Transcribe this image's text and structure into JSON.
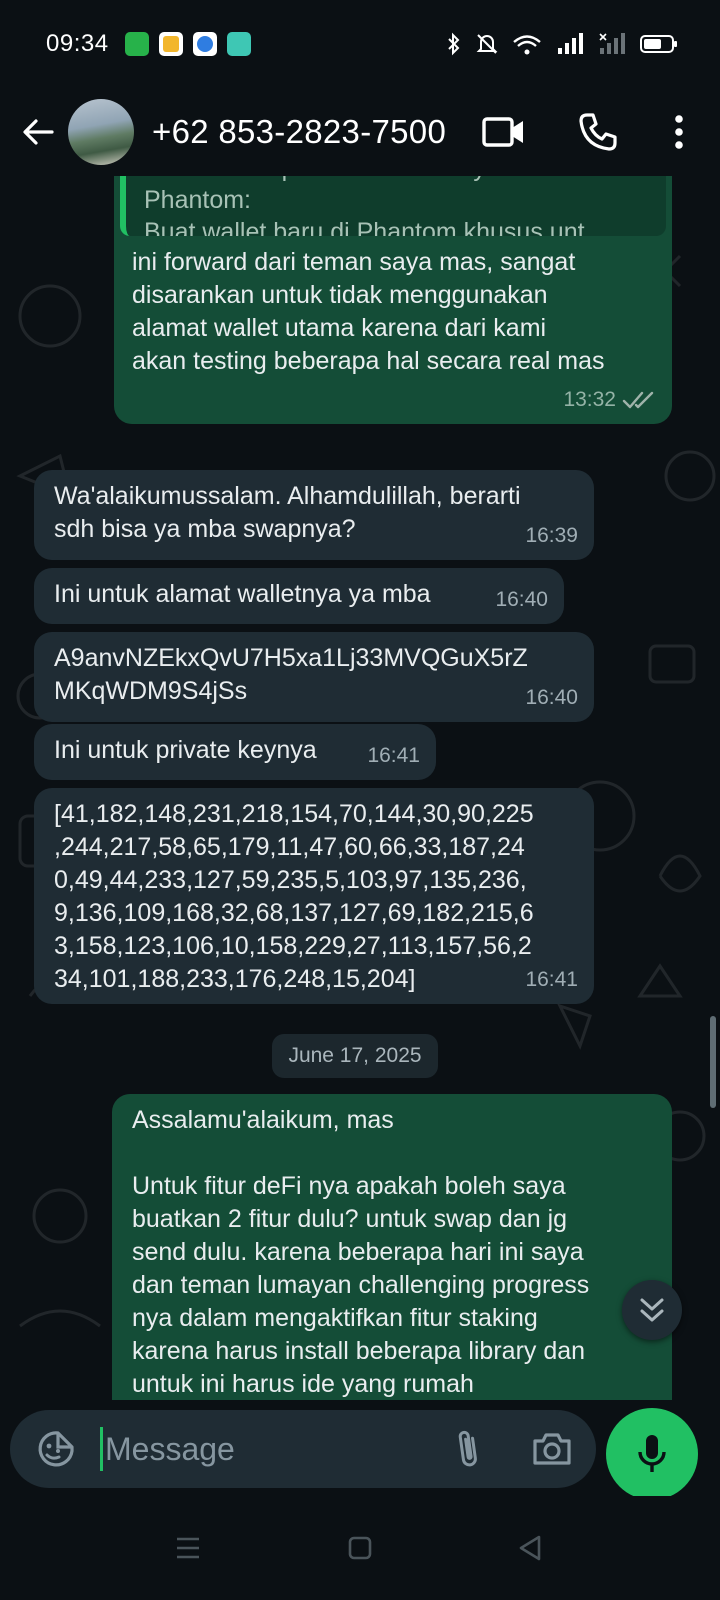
{
  "status_bar": {
    "time": "09:34",
    "app_icons": [
      {
        "name": "calculator-app-icon",
        "color": "#27b24a"
      },
      {
        "name": "notes-app-icon",
        "color": "#f2b62c"
      },
      {
        "name": "browser-app-icon",
        "color": "#2f7de1"
      },
      {
        "name": "assistant-app-icon",
        "color": "#3ec7b4"
      }
    ],
    "bluetooth": "on",
    "notifications": "muted",
    "wifi": "connected",
    "battery_level": 0.55
  },
  "header": {
    "contact_name": "+62 853-2823-7500",
    "icons": [
      "back-arrow-icon",
      "video-call-icon",
      "phone-call-icon",
      "more-options-icon"
    ]
  },
  "chat": {
    "messages": [
      {
        "id": "m1",
        "direction": "outgoing",
        "quote": {
          "line1": "Cara Mendapatkan Secret Key dari",
          "line2": "Phantom:",
          "line3": "Buat wallet baru di Phantom khusus unt..."
        },
        "text": "ini forward dari teman saya mas, sangat\ndisarankan untuk tidak menggunakan\nalamat wallet utama karena dari kami\nakan testing beberapa hal secara real mas",
        "time": "13:32",
        "status": "read"
      },
      {
        "id": "m2",
        "direction": "incoming",
        "text": "Wa'alaikumussalam. Alhamdulillah, berarti\nsdh bisa ya mba swapnya?",
        "time": "16:39"
      },
      {
        "id": "m3",
        "direction": "incoming",
        "text": "Ini untuk alamat walletnya ya mba",
        "time": "16:40"
      },
      {
        "id": "m4",
        "direction": "incoming",
        "text": "A9anvNZEkxQvU7H5xa1Lj33MVQGuX5rZ\nMKqWDM9S4jSs",
        "time": "16:40"
      },
      {
        "id": "m5",
        "direction": "incoming",
        "text": "Ini untuk private keynya",
        "time": "16:41"
      },
      {
        "id": "m6",
        "direction": "incoming",
        "text": "[41,182,148,231,218,154,70,144,30,90,225\n,244,217,58,65,179,11,47,60,66,33,187,24\n0,49,44,233,127,59,235,5,103,97,135,236,\n9,136,109,168,32,68,137,127,69,182,215,6\n3,158,123,106,10,158,229,27,113,157,56,2\n34,101,188,233,176,248,15,204]",
        "time": "16:41"
      },
      {
        "id": "m7",
        "direction": "outgoing",
        "text": "Assalamu'alaikum, mas\n\nUntuk fitur deFi nya apakah boleh saya\nbuatkan 2 fitur dulu? untuk swap dan jg\nsend dulu. karena beberapa hari ini saya\ndan teman lumayan challenging progress\nnya dalam mengaktifkan fitur staking\nkarena harus install beberapa library dan\nuntuk ini harus ide yang rumah",
        "time": ""
      }
    ],
    "date_separator": "June 17, 2025"
  },
  "input": {
    "placeholder": "Message",
    "value": ""
  },
  "colors": {
    "background": "#0b1014",
    "outgoing_bubble": "#144d37",
    "incoming_bubble": "#1f2c34",
    "accent": "#21c063",
    "read_ticks": "#9fb3aa"
  },
  "nav_bar": {
    "icons": [
      "recent-apps-icon",
      "home-icon",
      "back-icon"
    ]
  }
}
